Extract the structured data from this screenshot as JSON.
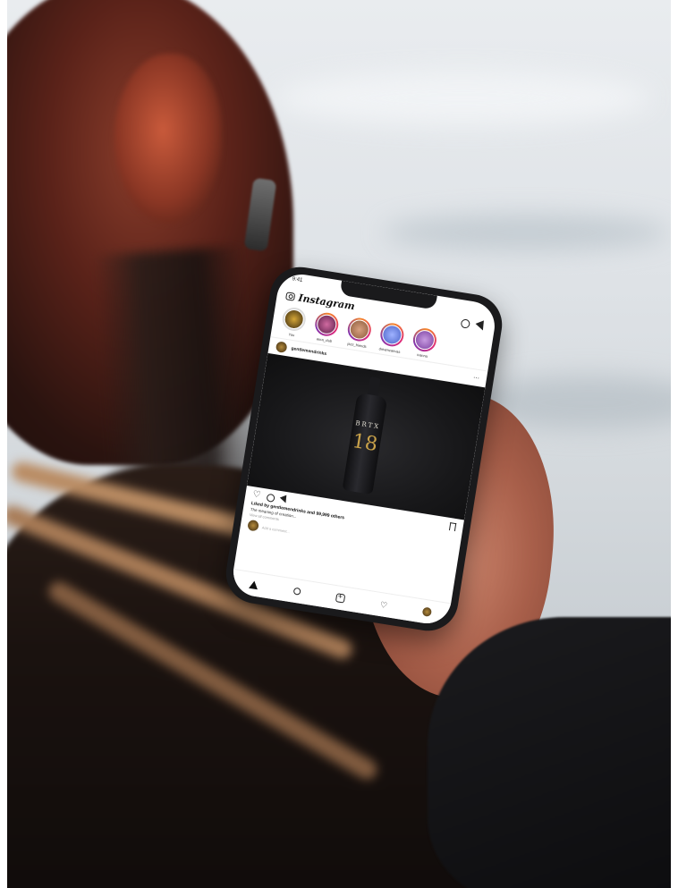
{
  "phone": {
    "status_time": "9:41",
    "app_logo": "Instagram",
    "icons": {
      "camera": "camera-icon",
      "igtv": "igtv-icon",
      "direct": "send-icon"
    },
    "stories": [
      {
        "name": "You",
        "color": "#3a2a10",
        "own": true
      },
      {
        "name": "aura_club",
        "color": "#5b1f4a"
      },
      {
        "name": "jazz_friends",
        "color": "#8a5a3a"
      },
      {
        "name": "dreamcanvas",
        "color": "#4b64c8"
      },
      {
        "name": "ivanna",
        "color": "#7a3fa0"
      }
    ],
    "post": {
      "username": "gentlemendrinks",
      "image_text_top": "BRTX",
      "image_text_number": "18",
      "likes": "Liked by gentlemendrinks and 99,999 others",
      "caption": "The meaning of creation...",
      "comments_link": "View all comments",
      "comment_placeholder": "Add a comment..."
    },
    "tabbar": [
      "home-icon",
      "search-icon",
      "add-icon",
      "activity-icon",
      "profile-icon"
    ]
  }
}
